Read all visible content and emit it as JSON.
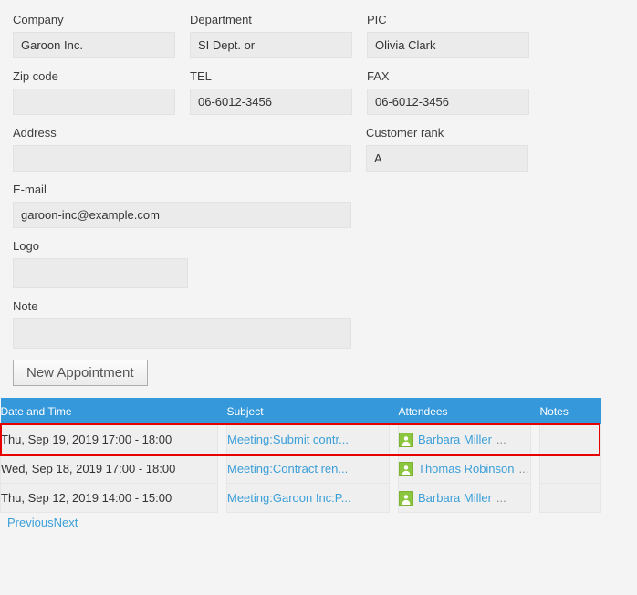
{
  "form": {
    "rows": [
      [
        {
          "label": "Company",
          "value": "Garoon Inc.",
          "name": "company"
        },
        {
          "label": "Department",
          "value": "SI Dept. or",
          "name": "department"
        },
        {
          "label": "PIC",
          "value": "Olivia Clark",
          "name": "pic"
        }
      ],
      [
        {
          "label": "Zip code",
          "value": "",
          "name": "zip-code"
        },
        {
          "label": "TEL",
          "value": "06-6012-3456",
          "name": "tel"
        },
        {
          "label": "FAX",
          "value": "06-6012-3456",
          "name": "fax"
        }
      ]
    ],
    "address": {
      "label": "Address",
      "value": "",
      "name": "address"
    },
    "customer_rank": {
      "label": "Customer rank",
      "value": "A",
      "name": "customer-rank"
    },
    "email": {
      "label": "E-mail",
      "value": "garoon-inc@example.com",
      "name": "email"
    },
    "logo": {
      "label": "Logo",
      "value": "",
      "name": "logo"
    },
    "note": {
      "label": "Note",
      "value": "",
      "name": "note"
    }
  },
  "buttons": {
    "new_appointment": "New Appointment"
  },
  "table": {
    "headers": {
      "date_time": "Date and Time",
      "subject": "Subject",
      "attendees": "Attendees",
      "notes": "Notes"
    },
    "header_color": "#3498db",
    "highlight_color": "#e60000",
    "link_color": "#3b9fd8",
    "rows": [
      {
        "date_time": "Thu, Sep 19, 2019 17:00 - 18:00",
        "subject": "Meeting:Submit contr...",
        "attendee": "Barbara Miller",
        "attendee_more": "...",
        "attendee_icon": "person-icon",
        "notes": "",
        "highlighted": true
      },
      {
        "date_time": "Wed, Sep 18, 2019 17:00 - 18:00",
        "subject": "Meeting:Contract ren...",
        "attendee": "Thomas Robinson",
        "attendee_more": "...",
        "attendee_icon": "person-icon",
        "notes": "",
        "highlighted": false
      },
      {
        "date_time": "Thu, Sep 12, 2019 14:00 - 15:00",
        "subject": "Meeting:Garoon Inc:P...",
        "attendee": "Barbara Miller",
        "attendee_more": "...",
        "attendee_icon": "person-icon",
        "notes": "",
        "highlighted": false
      }
    ]
  },
  "pager": {
    "previous": "Previous",
    "next": "Next"
  }
}
